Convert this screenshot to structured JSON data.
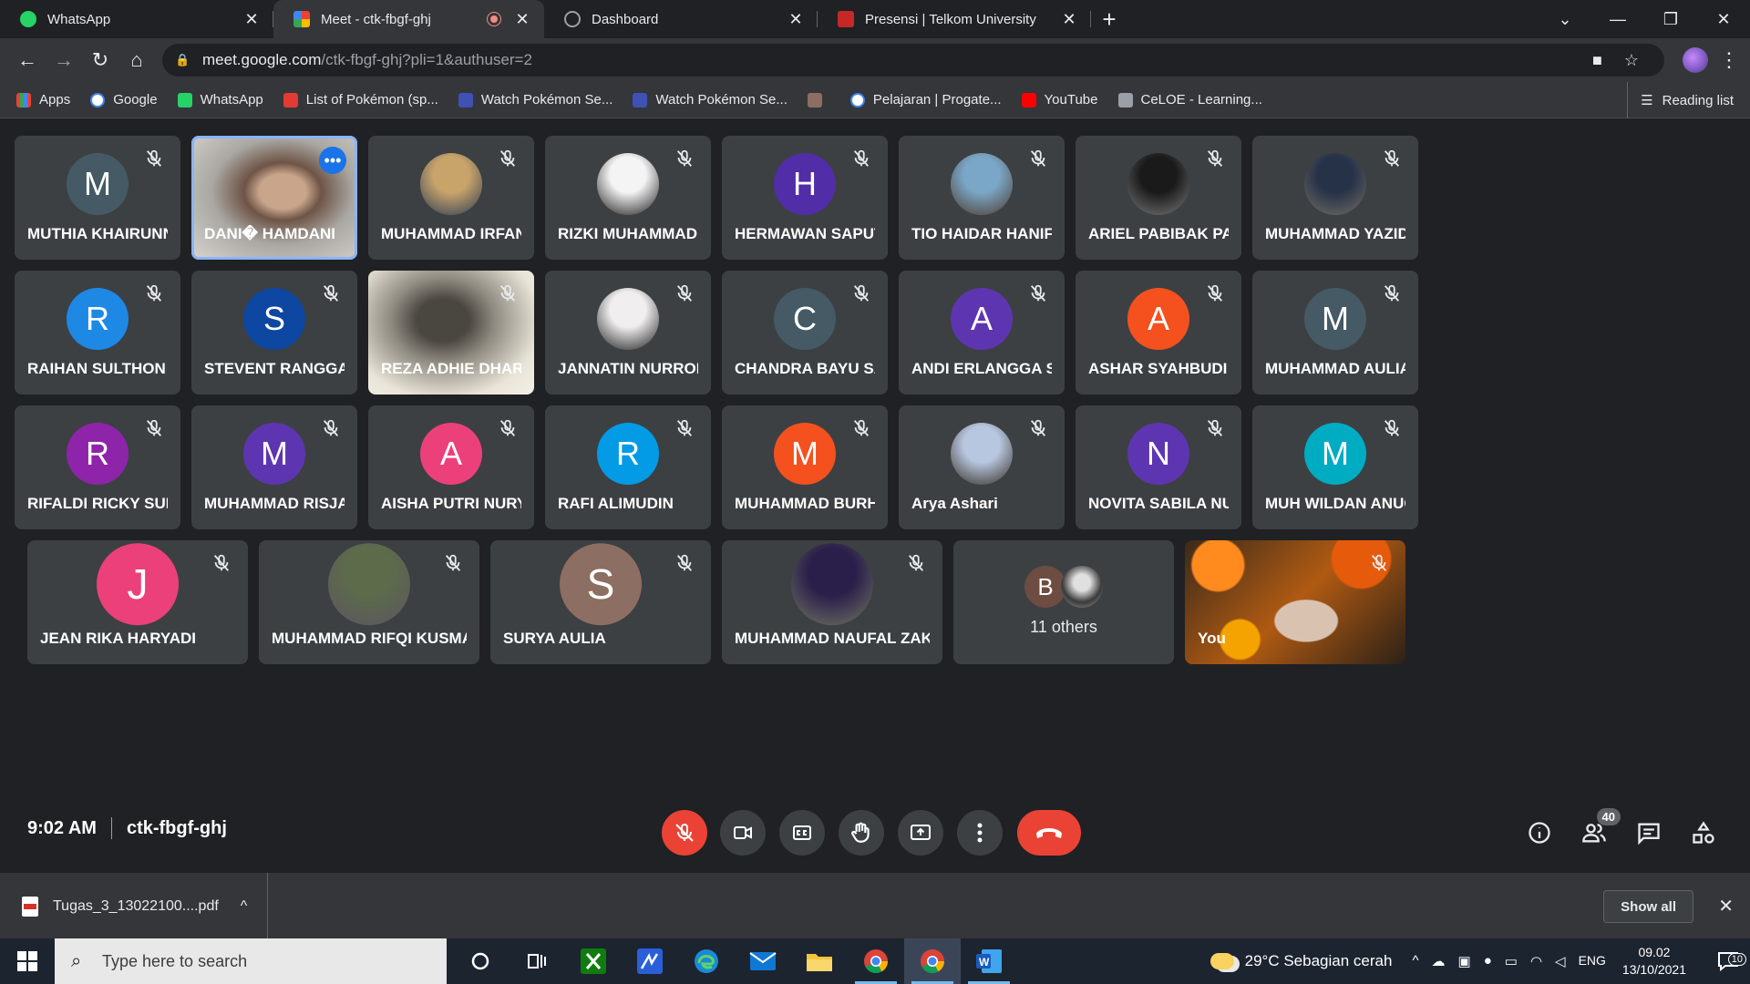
{
  "browser": {
    "tabs": [
      {
        "title": "WhatsApp",
        "icon": "whatsapp-icon",
        "color": "#25d366"
      },
      {
        "title": "Meet - ctk-fbgf-ghj",
        "icon": "meet-icon",
        "color": "#00832d",
        "active": true
      },
      {
        "title": "Dashboard",
        "icon": "dashboard-icon",
        "color": "#9aa0a6"
      },
      {
        "title": "Presensi | Telkom University",
        "icon": "telkom-icon",
        "color": "#c62828"
      }
    ],
    "url_host": "meet.google.com",
    "url_path": "/ctk-fbgf-ghj?pli=1&authuser=2",
    "bookmarks": [
      {
        "label": "Apps",
        "color": "#4285f4"
      },
      {
        "label": "Google",
        "color": "#ffffff"
      },
      {
        "label": "WhatsApp",
        "color": "#25d366"
      },
      {
        "label": "List of Pokémon (sp...",
        "color": "#e53935"
      },
      {
        "label": "Watch Pokémon Se...",
        "color": "#3f51b5"
      },
      {
        "label": "Watch Pokémon Se...",
        "color": "#3f51b5"
      },
      {
        "label": "",
        "color": "#8d6e63"
      },
      {
        "label": "Pelajaran | Progate...",
        "color": "#ffffff"
      },
      {
        "label": "YouTube",
        "color": "#ff0000"
      },
      {
        "label": "CeLOE - Learning...",
        "color": "#9aa0a6"
      }
    ],
    "reading_list": "Reading list"
  },
  "meet": {
    "participants": [
      {
        "name": "MUTHIA KHAIRUNNISA",
        "initial": "M",
        "color": "#455a64"
      },
      {
        "name": "DANI� HAMDANI",
        "initial": "",
        "color": "#6b6a66",
        "video": true,
        "pinned": true
      },
      {
        "name": "MUHAMMAD IRFAN S...",
        "initial": "",
        "color": "#c9a46a",
        "photo": true
      },
      {
        "name": "RIZKI MUHAMMAD RI...",
        "initial": "",
        "color": "#f4f4f4",
        "photo": true
      },
      {
        "name": "HERMAWAN SAPUTRA",
        "initial": "H",
        "color": "#512da8"
      },
      {
        "name": "TIO HAIDAR HANIF",
        "initial": "",
        "color": "#7aa7c7",
        "photo": true
      },
      {
        "name": "ARIEL PABIBAK PALI' ...",
        "initial": "",
        "color": "#1a1a1a",
        "photo": true
      },
      {
        "name": "MUHAMMAD YAZID F...",
        "initial": "",
        "color": "#263248",
        "photo": true
      },
      {
        "name": "RAIHAN SULTHON YA...",
        "initial": "R",
        "color": "#1e88e5"
      },
      {
        "name": "STEVENT RANGGA R...",
        "initial": "S",
        "color": "#0d47a1"
      },
      {
        "name": "REZA ADHIE DHAR...",
        "initial": "",
        "color": "#7d7a72",
        "video": true
      },
      {
        "name": "JANNATIN NURROH...",
        "initial": "",
        "color": "#f0eeee",
        "photo": true
      },
      {
        "name": "CHANDRA BAYU SAM...",
        "initial": "C",
        "color": "#455a64"
      },
      {
        "name": "ANDI ERLANGGA SU...",
        "initial": "A",
        "color": "#5e35b1"
      },
      {
        "name": "ASHAR SYAHBUDI SA...",
        "initial": "A",
        "color": "#f4511e"
      },
      {
        "name": "MUHAMMAD AULIA ...",
        "initial": "M",
        "color": "#455a64"
      },
      {
        "name": "RIFALDI RICKY SURYA...",
        "initial": "R",
        "color": "#8e24aa"
      },
      {
        "name": "MUHAMMAD RISJAD...",
        "initial": "M",
        "color": "#5e35b1"
      },
      {
        "name": "AISHA PUTRI NURYAN",
        "initial": "A",
        "color": "#ec407a"
      },
      {
        "name": "RAFI ALIMUDIN",
        "initial": "R",
        "color": "#039be5"
      },
      {
        "name": "MUHAMMAD BURHAN",
        "initial": "M",
        "color": "#f4511e"
      },
      {
        "name": "Arya Ashari",
        "initial": "",
        "color": "#b8c7e0",
        "photo": true
      },
      {
        "name": "NOVITA SABILA NUG...",
        "initial": "N",
        "color": "#5e35b1"
      },
      {
        "name": "MUH WILDAN ANUG...",
        "initial": "M",
        "color": "#00acc1"
      }
    ],
    "bottom_row": [
      {
        "name": "JEAN RIKA HARYADI",
        "initial": "J",
        "color": "#ec407a"
      },
      {
        "name": "MUHAMMAD RIFQI KUSMAYADI",
        "initial": "",
        "color": "#5d6b4a",
        "photo": true
      },
      {
        "name": "SURYA AULIA",
        "initial": "S",
        "color": "#8d6e63"
      },
      {
        "name": "MUHAMMAD NAUFAL ZAKI PE...",
        "initial": "",
        "color": "#2a1f4a",
        "photo": true
      }
    ],
    "others": {
      "initial": "B",
      "label": "11 others",
      "color": "#6d4c41"
    },
    "self": {
      "name": "You"
    },
    "time": "9:02 AM",
    "meeting_code": "ctk-fbgf-ghj",
    "participant_count": "40"
  },
  "downloads": {
    "file": "Tugas_3_13022100....pdf",
    "show_all": "Show all"
  },
  "taskbar": {
    "search_placeholder": "Type here to search",
    "weather": "29°C  Sebagian cerah",
    "lang": "ENG",
    "time": "09.02",
    "date": "13/10/2021",
    "notifications": "10"
  }
}
